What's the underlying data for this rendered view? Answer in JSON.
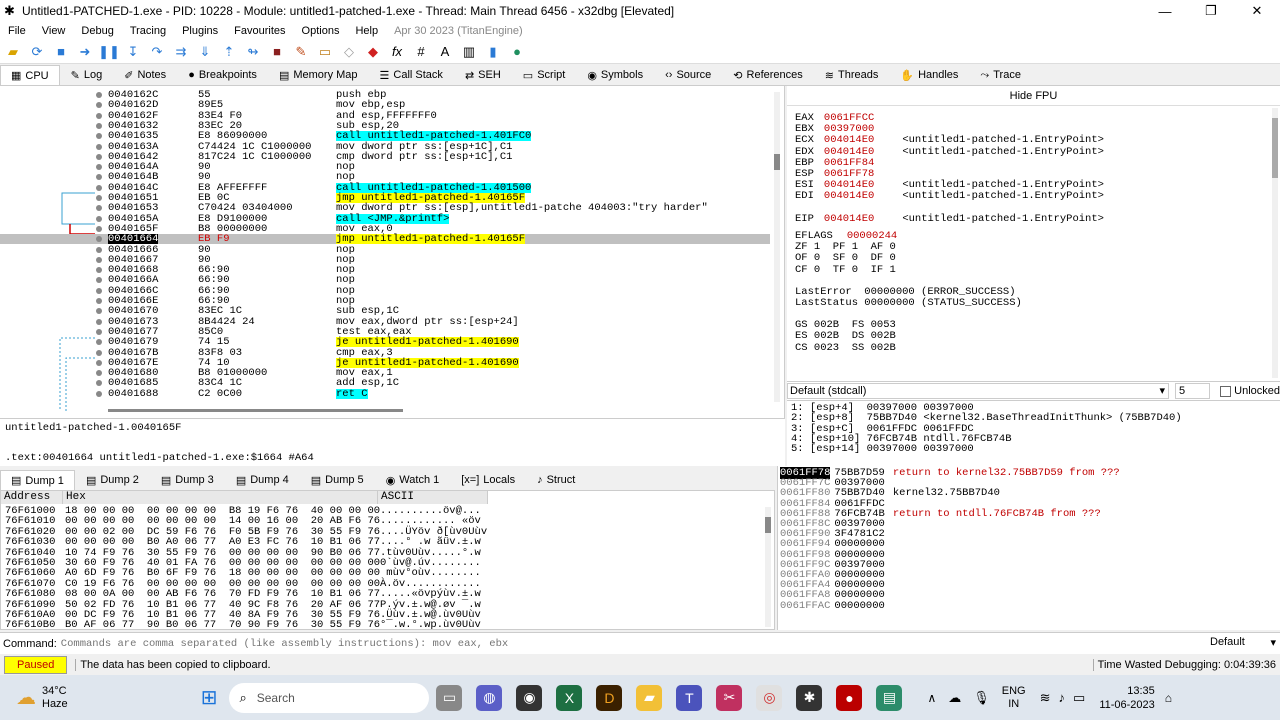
{
  "window": {
    "title": "Untitled1-PATCHED-1.exe - PID: 10228 - Module: untitled1-patched-1.exe - Thread: Main Thread 6456 - x32dbg [Elevated]",
    "min": "—",
    "max": "❐",
    "close": "✕"
  },
  "menu": [
    "File",
    "View",
    "Debug",
    "Tracing",
    "Plugins",
    "Favourites",
    "Options",
    "Help"
  ],
  "menu_date": "Apr 30 2023 (TitanEngine)",
  "toolbar_icons": [
    "open-icon",
    "restart-icon",
    "close-icon",
    "run-icon",
    "pause-icon",
    "step-into-icon",
    "step-over-icon",
    "trace-into-icon",
    "trace-over-icon",
    "execute-till-return-icon",
    "run-to-user-code-icon",
    "stop-icon",
    "patch-icon",
    "comment-icon",
    "label-icon",
    "bookmark-icon",
    "function-icon",
    "hash-icon",
    "font-icon",
    "calculator-icon",
    "help-icon",
    "globe-icon"
  ],
  "tabs": [
    {
      "label": "CPU",
      "icon": "▦"
    },
    {
      "label": "Log",
      "icon": "✎"
    },
    {
      "label": "Notes",
      "icon": "✐"
    },
    {
      "label": "Breakpoints",
      "icon": "●"
    },
    {
      "label": "Memory Map",
      "icon": "▤"
    },
    {
      "label": "Call Stack",
      "icon": "☰"
    },
    {
      "label": "SEH",
      "icon": "⇄"
    },
    {
      "label": "Script",
      "icon": "▭"
    },
    {
      "label": "Symbols",
      "icon": "◉"
    },
    {
      "label": "Source",
      "icon": "‹›"
    },
    {
      "label": "References",
      "icon": "⟲"
    },
    {
      "label": "Threads",
      "icon": "≋"
    },
    {
      "label": "Handles",
      "icon": "✋"
    },
    {
      "label": "Trace",
      "icon": "⤳"
    }
  ],
  "disasm": [
    {
      "addr": "0040162C",
      "bytes": "55",
      "instr": "push ebp"
    },
    {
      "addr": "0040162D",
      "bytes": "89E5",
      "instr": "mov ebp,esp"
    },
    {
      "addr": "0040162F",
      "bytes": "83E4 F0",
      "instr": "and esp,FFFFFFF0"
    },
    {
      "addr": "00401632",
      "bytes": "83EC 20",
      "instr": "sub esp,20"
    },
    {
      "addr": "00401635",
      "bytes": "E8 86090000",
      "instr": "call untitled1-patched-1.401FC0",
      "kind": "call"
    },
    {
      "addr": "0040163A",
      "bytes": "C74424 1C C1000000",
      "instr": "mov dword ptr ss:[esp+1C],C1"
    },
    {
      "addr": "00401642",
      "bytes": "817C24 1C C1000000",
      "instr": "cmp dword ptr ss:[esp+1C],C1"
    },
    {
      "addr": "0040164A",
      "bytes": "90",
      "instr": "nop"
    },
    {
      "addr": "0040164B",
      "bytes": "90",
      "instr": "nop"
    },
    {
      "addr": "0040164C",
      "bytes": "E8 AFFEFFFF",
      "instr": "call untitled1-patched-1.401500",
      "kind": "call"
    },
    {
      "addr": "00401651",
      "bytes": "EB 0C",
      "instr": "jmp untitled1-patched-1.40165F",
      "kind": "jmp"
    },
    {
      "addr": "00401653",
      "bytes": "C70424 03404000",
      "instr": "mov dword ptr ss:[esp],untitled1-patche 404003:\"try harder\""
    },
    {
      "addr": "0040165A",
      "bytes": "E8 D9100000",
      "instr": "call <JMP.&printf>",
      "kind": "call"
    },
    {
      "addr": "0040165F",
      "bytes": "B8 00000000",
      "instr": "mov eax,0"
    },
    {
      "addr": "00401664",
      "bytes": "EB F9",
      "instr": "jmp untitled1-patched-1.40165F",
      "kind": "jmp",
      "sel": true
    },
    {
      "addr": "00401666",
      "bytes": "90",
      "instr": "nop"
    },
    {
      "addr": "00401667",
      "bytes": "90",
      "instr": "nop"
    },
    {
      "addr": "00401668",
      "bytes": "66:90",
      "instr": "nop"
    },
    {
      "addr": "0040166A",
      "bytes": "66:90",
      "instr": "nop"
    },
    {
      "addr": "0040166C",
      "bytes": "66:90",
      "instr": "nop"
    },
    {
      "addr": "0040166E",
      "bytes": "66:90",
      "instr": "nop"
    },
    {
      "addr": "00401670",
      "bytes": "83EC 1C",
      "instr": "sub esp,1C"
    },
    {
      "addr": "00401673",
      "bytes": "8B4424 24",
      "instr": "mov eax,dword ptr ss:[esp+24]"
    },
    {
      "addr": "00401677",
      "bytes": "85C0",
      "instr": "test eax,eax"
    },
    {
      "addr": "00401679",
      "bytes": "74 15",
      "instr": "je untitled1-patched-1.401690",
      "kind": "jmp"
    },
    {
      "addr": "0040167B",
      "bytes": "83F8 03",
      "instr": "cmp eax,3"
    },
    {
      "addr": "0040167E",
      "bytes": "74 10",
      "instr": "je untitled1-patched-1.401690",
      "kind": "jmp"
    },
    {
      "addr": "00401680",
      "bytes": "B8 01000000",
      "instr": "mov eax,1"
    },
    {
      "addr": "00401685",
      "bytes": "83C4 1C",
      "instr": "add esp,1C"
    },
    {
      "addr": "00401688",
      "bytes": "C2 0C00",
      "instr": "ret C",
      "kind": "call"
    }
  ],
  "info_lines": [
    "untitled1-patched-1.0040165F",
    "",
    ".text:00401664 untitled1-patched-1.exe:$1664 #A64"
  ],
  "regs_header": "Hide FPU",
  "registers": [
    {
      "name": "EAX",
      "value": "0061FFCC",
      "comment": ""
    },
    {
      "name": "EBX",
      "value": "00397000",
      "comment": ""
    },
    {
      "name": "ECX",
      "value": "004014E0",
      "comment": "<untitled1-patched-1.EntryPoint>"
    },
    {
      "name": "EDX",
      "value": "004014E0",
      "comment": "<untitled1-patched-1.EntryPoint>"
    },
    {
      "name": "EBP",
      "value": "0061FF84",
      "comment": ""
    },
    {
      "name": "ESP",
      "value": "0061FF78",
      "comment": ""
    },
    {
      "name": "ESI",
      "value": "004014E0",
      "comment": "<untitled1-patched-1.EntryPoint>"
    },
    {
      "name": "EDI",
      "value": "004014E0",
      "comment": "<untitled1-patched-1.EntryPoint>"
    },
    {
      "name": "",
      "value": "",
      "comment": ""
    },
    {
      "name": "EIP",
      "value": "004014E0",
      "comment": "<untitled1-patched-1.EntryPoint>"
    }
  ],
  "eflags": {
    "label": "EFLAGS",
    "value": "00000244"
  },
  "flags": [
    "ZF 1  PF 1  AF 0",
    "OF 0  SF 0  DF 0",
    "CF 0  TF 0  IF 1"
  ],
  "last": [
    "LastError  00000000 (ERROR_SUCCESS)",
    "LastStatus 00000000 (STATUS_SUCCESS)"
  ],
  "segs": [
    "GS 002B  FS 0053",
    "ES 002B  DS 002B",
    "CS 0023  SS 002B"
  ],
  "callconv": {
    "value": "Default (stdcall)",
    "count": "5",
    "unlocked": "Unlocked"
  },
  "stack_args": [
    "1: [esp+4]  00397000 00397000",
    "2: [esp+8]  75BB7D40 <kernel32.BaseThreadInitThunk> (75BB7D40)",
    "3: [esp+C]  0061FFDC 0061FFDC",
    "4: [esp+10] 76FCB74B ntdll.76FCB74B",
    "5: [esp+14] 00397000 00397000"
  ],
  "dump_tabs": [
    {
      "label": "Dump 1",
      "icon": "▤"
    },
    {
      "label": "Dump 2",
      "icon": "▤"
    },
    {
      "label": "Dump 3",
      "icon": "▤"
    },
    {
      "label": "Dump 4",
      "icon": "▤"
    },
    {
      "label": "Dump 5",
      "icon": "▤"
    },
    {
      "label": "Watch 1",
      "icon": "◉"
    },
    {
      "label": "Locals",
      "icon": "[x=]"
    },
    {
      "label": "Struct",
      "icon": "♪"
    }
  ],
  "dump_headers": {
    "address": "Address",
    "hex": "Hex",
    "ascii": "ASCII"
  },
  "dump": [
    {
      "addr": "76F61000",
      "hex": "18 00 00 00  00 00 00 00  B8 19 F6 76  40 00 00 00",
      "ascii": "..........öv@..."
    },
    {
      "addr": "76F61010",
      "hex": "00 00 00 00  00 00 00 00  14 00 16 00  20 AB F6 76",
      "ascii": "............ «öv"
    },
    {
      "addr": "76F61020",
      "hex": "00 00 02 00  DC 59 F6 76  F0 5B F9 76  30 55 F9 76",
      "ascii": "....ÜYöv ð[ùv0Uùv"
    },
    {
      "addr": "76F61030",
      "hex": "00 00 00 00  B0 A0 06 77  A0 E3 FC 76  10 B1 06 77",
      "ascii": "....° .w ãüv.±.w"
    },
    {
      "addr": "76F61040",
      "hex": "10 74 F9 76  30 55 F9 76  00 00 00 00  90 B0 06 77",
      "ascii": ".tùv0Uùv.....°.w"
    },
    {
      "addr": "76F61050",
      "hex": "30 60 F9 76  40 01 FA 76  00 00 00 00  00 00 00 00",
      "ascii": "0`ùv@.úv........"
    },
    {
      "addr": "76F61060",
      "hex": "A0 6D F9 76  B0 6F F9 76  18 00 00 00  00 00 00 00",
      " ascii": "",
      "ascii": " mùv°oùv........"
    },
    {
      "addr": "76F61070",
      "hex": "C0 19 F6 76  00 00 00 00  00 00 00 00  00 00 00 00",
      "ascii": "À.öv............"
    },
    {
      "addr": "76F61080",
      "hex": "08 00 0A 00  00 AB F6 76  70 FD F9 76  10 B1 06 77",
      "ascii": ".....«övpýùv.±.w"
    },
    {
      "addr": "76F61090",
      "hex": "50 02 FD 76  10 B1 06 77  40 9C F8 76  20 AF 06 77",
      "ascii": "P.ýv.±.w@.øv ¯.w"
    },
    {
      "addr": "76F610A0",
      "hex": "00 DC F9 76  10 B1 06 77  40 8A F9 76  30 55 F9 76",
      "ascii": ".Üùv.±.w@.ùv0Uùv"
    },
    {
      "addr": "76F610B0",
      "hex": "B0 AF 06 77  90 B0 06 77  70 90 F9 76  30 55 F9 76",
      "ascii": "°¯.w.°.wp.ùv0Uùv"
    }
  ],
  "stack": [
    {
      "addr": "0061FF78",
      "val": "75BB7D59",
      "cmt": "return to kernel32.75BB7D59 from ???",
      "top": true
    },
    {
      "addr": "0061FF7C",
      "val": "00397000",
      "cmt": ""
    },
    {
      "addr": "0061FF80",
      "val": "75BB7D40",
      "cmt": "kernel32.75BB7D40",
      "plain": true
    },
    {
      "addr": "0061FF84",
      "val": "0061FFDC",
      "cmt": ""
    },
    {
      "addr": "0061FF88",
      "val": "76FCB74B",
      "cmt": "return to ntdll.76FCB74B from ???"
    },
    {
      "addr": "0061FF8C",
      "val": "00397000",
      "cmt": ""
    },
    {
      "addr": "0061FF90",
      "val": "3F4781C2",
      "cmt": ""
    },
    {
      "addr": "0061FF94",
      "val": "00000000",
      "cmt": ""
    },
    {
      "addr": "0061FF98",
      "val": "00000000",
      "cmt": ""
    },
    {
      "addr": "0061FF9C",
      "val": "00397000",
      "cmt": ""
    },
    {
      "addr": "0061FFA0",
      "val": "00000000",
      "cmt": ""
    },
    {
      "addr": "0061FFA4",
      "val": "00000000",
      "cmt": ""
    },
    {
      "addr": "0061FFA8",
      "val": "00000000",
      "cmt": ""
    },
    {
      "addr": "0061FFAC",
      "val": "00000000",
      "cmt": ""
    }
  ],
  "cmd": {
    "label": "Command:",
    "placeholder": "Commands are comma separated (like assembly instructions): mov eax, ebx",
    "mode": "Default"
  },
  "status": {
    "state": "Paused",
    "message": "The data has been copied to clipboard.",
    "time": "Time Wasted Debugging: 0:04:39:36"
  },
  "taskbar": {
    "temp": "34°C",
    "weather": "Haze",
    "search": "Search",
    "lang1": "ENG",
    "lang2": "IN",
    "time": "13:35",
    "date": "11-06-2023"
  },
  "colors": {
    "accent_yellow": "#ffff00",
    "accent_cyan": "#00ffff",
    "reg_red": "#c00000",
    "paused": "#ffff00"
  }
}
